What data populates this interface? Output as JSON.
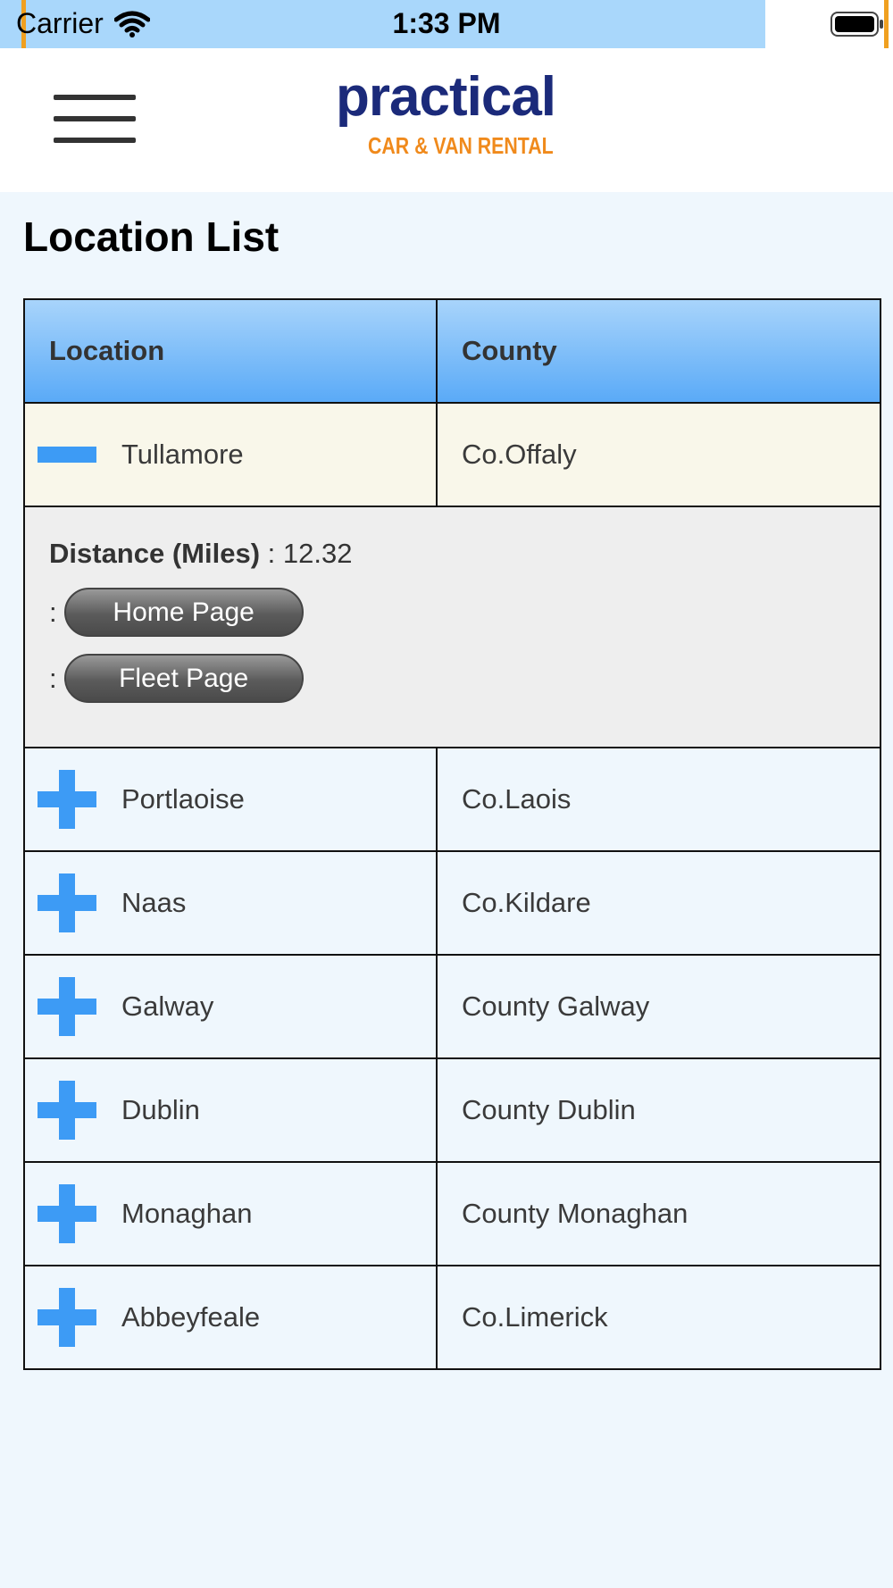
{
  "status_bar": {
    "carrier": "Carrier",
    "time": "1:33 PM",
    "wifi_icon": "wifi-icon",
    "battery_icon": "battery-icon"
  },
  "header": {
    "menu_icon": "hamburger-icon",
    "logo_top": "practical",
    "logo_bottom": "CAR & VAN RENTAL",
    "colors": {
      "logo_top": "#1b2a7a",
      "logo_bottom": "#f08a1c"
    }
  },
  "page": {
    "title": "Location List"
  },
  "table": {
    "headers": {
      "location": "Location",
      "county": "County"
    },
    "colors": {
      "header_top": "#a8d4fb",
      "header_bottom": "#5aaaf7",
      "toggle_icon": "#3d9bf5"
    },
    "rows": [
      {
        "location": "Tullamore",
        "county": "Co.Offaly",
        "icon": "minus-icon",
        "expanded": true
      },
      {
        "location": "Portlaoise",
        "county": "Co.Laois",
        "icon": "plus-icon"
      },
      {
        "location": "Naas",
        "county": "Co.Kildare",
        "icon": "plus-icon"
      },
      {
        "location": "Galway",
        "county": "County Galway",
        "icon": "plus-icon"
      },
      {
        "location": "Dublin",
        "county": "County Dublin",
        "icon": "plus-icon"
      },
      {
        "location": "Monaghan",
        "county": "County Monaghan",
        "icon": "plus-icon"
      },
      {
        "location": "Abbeyfeale",
        "county": "Co.Limerick",
        "icon": "plus-icon"
      }
    ],
    "detail": {
      "distance_label": "Distance (Miles)",
      "distance_sep": " : ",
      "distance_value": "12.32",
      "link_prefix": ":",
      "home_button": "Home Page",
      "fleet_button": "Fleet Page"
    }
  }
}
